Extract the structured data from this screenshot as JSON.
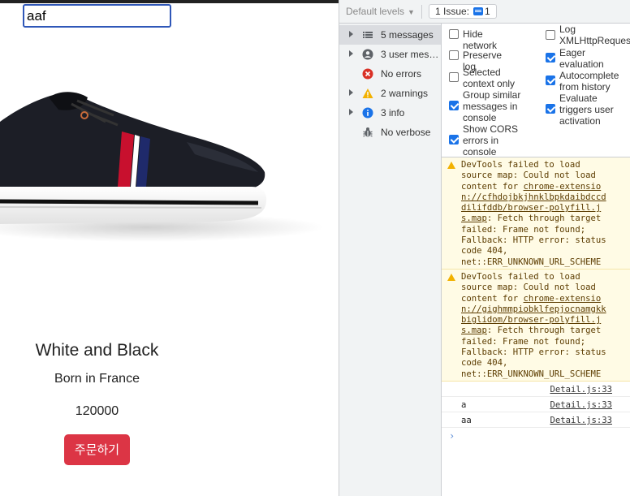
{
  "page": {
    "search_value": "aaf",
    "product": {
      "title": "White and Black",
      "origin": "Born in France",
      "price": "120000"
    },
    "order_button": "주문하기",
    "button_color": "#dc3545"
  },
  "devtools": {
    "toolbar": {
      "levels": "Default levels",
      "issues_label": "1 Issue:",
      "issues_count": "1"
    },
    "sidebar": [
      {
        "label": "5 messages",
        "icon": "list-icon",
        "expandable": true,
        "selected": true
      },
      {
        "label": "3 user mes…",
        "icon": "user-icon",
        "expandable": true,
        "selected": false
      },
      {
        "label": "No errors",
        "icon": "error-icon",
        "expandable": false,
        "selected": false
      },
      {
        "label": "2 warnings",
        "icon": "warning-icon",
        "expandable": true,
        "selected": false
      },
      {
        "label": "3 info",
        "icon": "info-icon",
        "expandable": true,
        "selected": false
      },
      {
        "label": "No verbose",
        "icon": "bug-icon",
        "expandable": false,
        "selected": false
      }
    ],
    "settings": {
      "hide_network": {
        "label": "Hide network",
        "checked": false
      },
      "preserve_log": {
        "label": "Preserve log",
        "checked": false
      },
      "selected_context": {
        "label": "Selected\ncontext only",
        "checked": false
      },
      "group_similar": {
        "label": "Group similar\nmessages in\nconsole",
        "checked": true
      },
      "show_cors": {
        "label": "Show CORS\nerrors in\nconsole",
        "checked": true
      },
      "log_xhr": {
        "label": "Log\nXMLHttpReques",
        "checked": false
      },
      "eager_eval": {
        "label": "Eager\nevaluation",
        "checked": true
      },
      "autocomplete": {
        "label": "Autocomplete\nfrom history",
        "checked": true
      },
      "evaluate_triggers": {
        "label": "Evaluate\ntriggers user\nactivation",
        "checked": true
      }
    },
    "messages": [
      {
        "type": "warning",
        "before": "DevTools failed to load\nsource map: Could not load\ncontent for ",
        "link": "chrome-extensio\nn://cfhdojbkjhnklbpkdaibdccd\ndilifddb/browser-polyfill.j\ns.map",
        "after": ": Fetch through target\nfailed: Frame not found;\nFallback: HTTP error: status\ncode 404,\nnet::ERR_UNKNOWN_URL_SCHEME"
      },
      {
        "type": "warning",
        "before": "DevTools failed to load\nsource map: Could not load\ncontent for ",
        "link": "chrome-extensio\nn://gighmmpiobklfepjocnamgkk\nbiglidom/browser-polyfill.j\ns.map",
        "after": ": Fetch through target\nfailed: Frame not found;\nFallback: HTTP error: status\ncode 404,\nnet::ERR_UNKNOWN_URL_SCHEME"
      }
    ],
    "logs": [
      {
        "text": "",
        "source": "Detail.js:33"
      },
      {
        "text": "a",
        "source": "Detail.js:33"
      },
      {
        "text": "aa",
        "source": "Detail.js:33"
      }
    ],
    "prompt": "›"
  }
}
